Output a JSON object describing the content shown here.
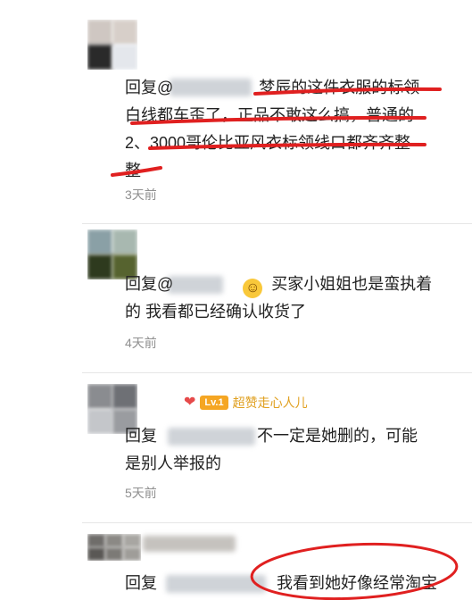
{
  "comments": [
    {
      "reply_prefix": "回复@",
      "text_lines": [
        "梦辰的这件衣服的标领",
        "白线都车歪了，正品不敢这么搞，普通的",
        "2、3000哥伦比亚风衣标领线口都齐齐整",
        "整"
      ],
      "time": "3天前"
    },
    {
      "reply_prefix": "回复@",
      "text_lines": [
        "买家小姐姐也是蛮执着",
        "的 我看都已经确认收货了"
      ],
      "time": "4天前",
      "emoji": "smile-emoji"
    },
    {
      "badge": {
        "level": "Lv.1",
        "nickname": "超赞走心人儿"
      },
      "reply_prefix": "回复",
      "text_lines": [
        "不一定是她删的，可能",
        "是别人举报的"
      ],
      "time": "5天前"
    },
    {
      "reply_prefix": "回复",
      "text_lines": [
        "我看到她好像经常淘宝"
      ]
    }
  ],
  "colors": {
    "annotation_red": "#e02020",
    "badge_orange": "#f5a623"
  }
}
